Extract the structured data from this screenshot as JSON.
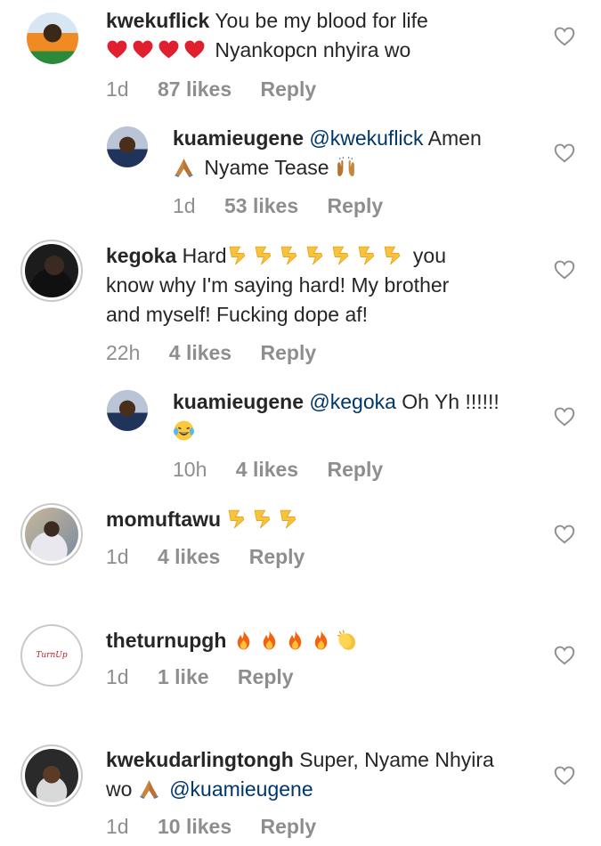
{
  "comments": [
    {
      "username": "kwekuflick",
      "text": "You be my blood for life",
      "line2_emojis": [
        "red-heart",
        "red-heart",
        "red-heart",
        "red-heart"
      ],
      "line2_text": "Nyankopcn nhyira wo",
      "time": "1d",
      "likes": "87 likes",
      "reply": "Reply"
    },
    {
      "username": "kuamieugene",
      "mention": "@kwekuflick",
      "text": "Amen",
      "line2_emoji": "folded-hands",
      "line2_text": "Nyame Tease",
      "line2_trailing_emoji": "raising-hands",
      "time": "1d",
      "likes": "53 likes",
      "reply": "Reply"
    },
    {
      "username": "kegoka",
      "text": "Hard",
      "emojis": [
        "lightning",
        "lightning",
        "lightning",
        "lightning",
        "lightning",
        "lightning",
        "lightning"
      ],
      "after_emojis": "you",
      "line2": "know why I'm saying hard! My brother",
      "line3": "and myself! Fucking dope af!",
      "time": "22h",
      "likes": "4 likes",
      "reply": "Reply"
    },
    {
      "username": "kuamieugene",
      "mention": "@kegoka",
      "text": "Oh Yh !!!!!!",
      "line2_emoji": "tears-of-joy",
      "time": "10h",
      "likes": "4 likes",
      "reply": "Reply"
    },
    {
      "username": "momuftawu",
      "emojis": [
        "lightning",
        "lightning",
        "lightning"
      ],
      "time": "1d",
      "likes": "4 likes",
      "reply": "Reply"
    },
    {
      "username": "theturnupgh",
      "emojis": [
        "fire",
        "fire",
        "fire",
        "fire",
        "clapping-hands"
      ],
      "avatar_text": "TurnUp",
      "time": "1d",
      "likes": "1 like",
      "reply": "Reply"
    },
    {
      "username": "kwekudarlingtongh",
      "text": "Super, Nyame Nhyira",
      "line2_text": "wo",
      "line2_emoji": "folded-hands",
      "mention": "@kuamieugene",
      "time": "1d",
      "likes": "10 likes",
      "reply": "Reply"
    }
  ]
}
